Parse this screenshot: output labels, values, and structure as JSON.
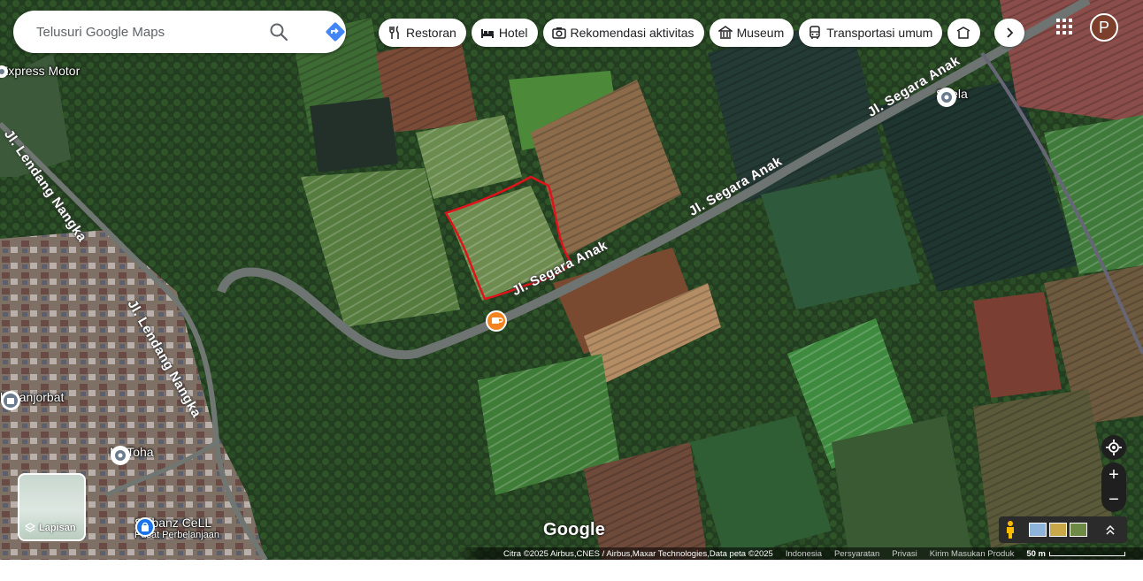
{
  "search": {
    "placeholder": "Telusuri Google Maps"
  },
  "chips": [
    {
      "label": "Restoran",
      "icon": "fork-knife-icon"
    },
    {
      "label": "Hotel",
      "icon": "bed-icon"
    },
    {
      "label": "Rekomendasi aktivitas",
      "icon": "camera-icon"
    },
    {
      "label": "Museum",
      "icon": "museum-icon"
    },
    {
      "label": "Transportasi umum",
      "icon": "bus-icon"
    }
  ],
  "account": {
    "initial": "P"
  },
  "places": {
    "express_motor": "Express Motor",
    "suela": "Suela",
    "imanjorbat": "l imanjorbat",
    "m_toha": "M. Toha",
    "sikbanz": "Sikbanz CeLL",
    "sikbanz_sub": "Pusat Perbelanjaan"
  },
  "roads": {
    "segara_1": "Jl. Segara Anak",
    "segara_2": "Jl. Segara Anak",
    "segara_3": "Jl. Segara Anak",
    "lendang_1": "Jl. Lendang Nangka",
    "lendang_2": "Jl. Lendang Nangka"
  },
  "layers": {
    "label": "Lapisan"
  },
  "logo": "Google",
  "footer": {
    "attribution": "Citra ©2025 Airbus,CNES / Airbus,Maxar Technologies,Data peta ©2025",
    "country": "Indonesia",
    "terms": "Persyaratan",
    "privacy": "Privasi",
    "feedback": "Kirim Masukan Produk",
    "scale": "50 m"
  },
  "colors": {
    "directions": "#4285f4",
    "boundary": "#e1131a",
    "cafe_pin": "#f4821f"
  }
}
